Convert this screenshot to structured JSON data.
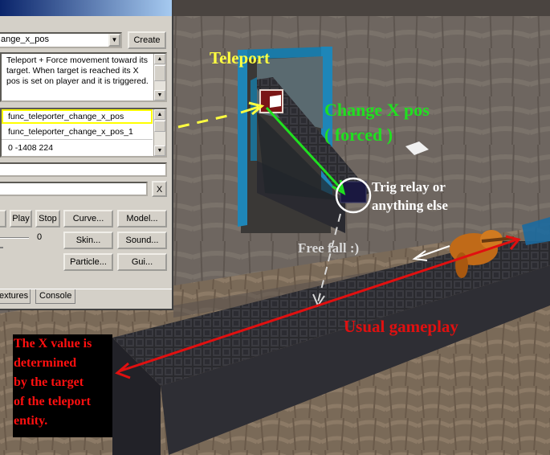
{
  "editor": {
    "classname_value": "ange_x_pos",
    "create_label": "Create",
    "description": "Teleport + Force movement toward its target. When target is reached its X pos is set on player and it is triggered.",
    "properties": [
      "func_teleporter_change_x_pos",
      "func_teleporter_change_x_pos_1",
      "0 -1408 224"
    ],
    "clear_label": "X",
    "play_label": "Play",
    "stop_label": "Stop",
    "slider_value": "0",
    "curve_label": "Curve...",
    "model_label": "Model...",
    "skin_label": "Skin...",
    "sound_label": "Sound...",
    "particle_label": "Particle...",
    "gui_label": "Gui...",
    "tabs": [
      "extures",
      "Console"
    ],
    "highlight_color": "#ffff00"
  },
  "annotations": {
    "teleport": "Teleport",
    "change_x_line1": "Change X pos",
    "change_x_line2": "( forced )",
    "trig_line1": "Trig relay or",
    "trig_line2": "anything else",
    "free_fall": "Free fall :)",
    "usual": "Usual gameplay",
    "x_note": [
      "The X value is",
      "determined",
      "by the target",
      "of the teleport",
      "entity."
    ]
  },
  "colors": {
    "yellow_label": "#ffff40",
    "green_label": "#20e020",
    "red_label": "#e01010",
    "white_label": "#ffffff",
    "gray_label": "#d8d8d8"
  }
}
